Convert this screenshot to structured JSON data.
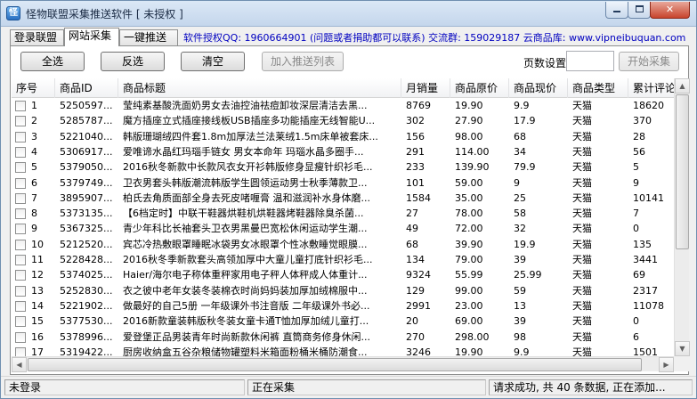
{
  "window": {
    "title": "怪物联盟采集推送软件 [ 未授权 ]",
    "icon_name": "app-icon"
  },
  "tabs": [
    {
      "label": "登录联盟",
      "active": false
    },
    {
      "label": "网站采集",
      "active": true
    },
    {
      "label": "一键推送",
      "active": false
    }
  ],
  "info_line": "软件授权QQ: 1960664901 (问题或者捐助都可以联系) 交流群: 159029187 云商品库: www.vipneibuquan.com",
  "toolbar": {
    "select_all": "全选",
    "invert": "反选",
    "clear": "清空",
    "add_push_list": "加入推送列表",
    "pages_label": "页数设置:",
    "pages_value": "",
    "start_collect": "开始采集"
  },
  "table": {
    "columns": [
      "序号",
      "商品ID",
      "商品标题",
      "月销量",
      "商品原价",
      "商品现价",
      "商品类型",
      "累计评论"
    ],
    "rows": [
      [
        "1",
        "5250597...",
        "莹纯素基酸洗面奶男女去油控油祛痘卸妆深层清洁去黑...",
        "8769",
        "19.90",
        "9.9",
        "天猫",
        "18620"
      ],
      [
        "2",
        "5285787...",
        "魔方插座立式插座接线板USB插座多功能插座无线智能U...",
        "302",
        "27.90",
        "17.9",
        "天猫",
        "370"
      ],
      [
        "3",
        "5221040...",
        "韩版珊瑚绒四件套1.8m加厚法兰法莱绒1.5m床单被套床...",
        "156",
        "98.00",
        "68",
        "天猫",
        "28"
      ],
      [
        "4",
        "5306917...",
        "爱唯谛水晶红玛瑙手链女 男女本命年 玛瑙水晶多圈手...",
        "291",
        "114.00",
        "34",
        "天猫",
        "56"
      ],
      [
        "5",
        "5379050...",
        "2016秋冬新款中长款风衣女开衫韩版修身显瘦针织衫毛...",
        "233",
        "139.90",
        "79.9",
        "天猫",
        "5"
      ],
      [
        "6",
        "5379749...",
        "卫衣男套头韩版潮流韩版学生圆领运动男士秋季薄款卫...",
        "101",
        "59.00",
        "9",
        "天猫",
        "9"
      ],
      [
        "7",
        "3895907...",
        "柏氏去角质面部全身去死皮啫喱膏 温和滋润补水身体磨...",
        "1584",
        "35.00",
        "25",
        "天猫",
        "10141"
      ],
      [
        "8",
        "5373135...",
        "【6档定时】中联干鞋器烘鞋机烘鞋器烤鞋器除臭杀菌...",
        "27",
        "78.00",
        "58",
        "天猫",
        "7"
      ],
      [
        "9",
        "5367325...",
        "青少年科比长袖套头卫衣男黑曼巴宽松休闲运动学生潮...",
        "49",
        "72.00",
        "32",
        "天猫",
        "0"
      ],
      [
        "10",
        "5212520...",
        "宾芯冷热敷眼罩睡眠冰袋男女冰眼罩个性冰敷睡觉眼膜...",
        "68",
        "39.90",
        "19.9",
        "天猫",
        "135"
      ],
      [
        "11",
        "5228428...",
        "2016秋冬季新款套头高领加厚中大童儿童打底针织衫毛...",
        "134",
        "79.00",
        "39",
        "天猫",
        "3441"
      ],
      [
        "12",
        "5374025...",
        "Haier/海尔电子称体重秤家用电子秤人体秤成人体重计...",
        "9324",
        "55.99",
        "25.99",
        "天猫",
        "69"
      ],
      [
        "13",
        "5252830...",
        "衣之彼中老年女装冬装棉衣时尚妈妈装加厚加绒棉服中...",
        "129",
        "99.00",
        "59",
        "天猫",
        "2317"
      ],
      [
        "14",
        "5221902...",
        "做最好的自己5册 一年级课外书注音版 二年级课外书必...",
        "2991",
        "23.00",
        "13",
        "天猫",
        "11078"
      ],
      [
        "15",
        "5377530...",
        "2016新款童装韩版秋冬装女童卡通T恤加厚加绒儿童打...",
        "20",
        "69.00",
        "39",
        "天猫",
        "0"
      ],
      [
        "16",
        "5378996...",
        "爱登堡正品男装青年时尚新款休闲裤 直筒商务修身休闲...",
        "270",
        "298.00",
        "98",
        "天猫",
        "6"
      ],
      [
        "17",
        "5319422...",
        "厨房收纳盒五谷杂粮储物罐塑料米箱面粉桶米桶防潮食...",
        "3246",
        "19.90",
        "9.9",
        "天猫",
        "1501"
      ]
    ]
  },
  "status": {
    "login": "未登录",
    "collecting": "正在采集",
    "message": "请求成功, 共 40 条数据, 正在添加..."
  }
}
